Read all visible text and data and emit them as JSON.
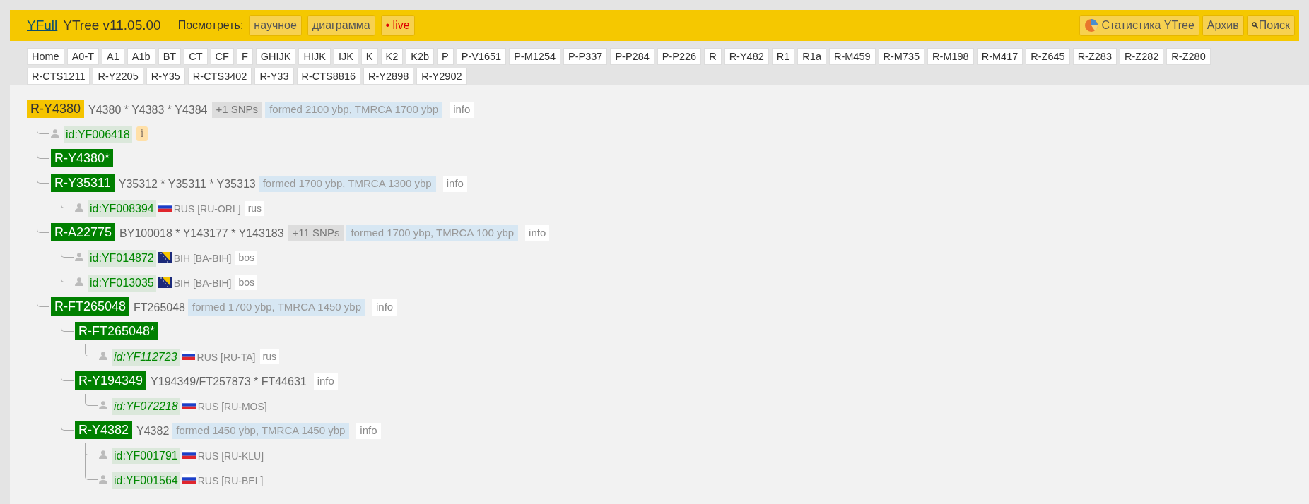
{
  "header": {
    "logo_link": "YFull",
    "title": "YTree v11.05.00",
    "view_label": "Посмотреть:",
    "view_buttons": [
      {
        "label": "научное",
        "kind": "plain"
      },
      {
        "label": "диаграмма",
        "kind": "plain"
      },
      {
        "label": "• live",
        "kind": "live"
      }
    ],
    "right_buttons": [
      {
        "label": "Статистика YTree",
        "kind": "stats"
      },
      {
        "label": "Архив",
        "kind": "plain"
      },
      {
        "label": "Поиск",
        "kind": "search"
      }
    ]
  },
  "tabs": [
    "Home",
    "A0-T",
    "A1",
    "A1b",
    "BT",
    "CT",
    "CF",
    "F",
    "GHIJK",
    "HIJK",
    "IJK",
    "K",
    "K2",
    "K2b",
    "P",
    "P-V1651",
    "P-M1254",
    "P-P337",
    "P-P284",
    "P-P226",
    "R",
    "R-Y482",
    "R1",
    "R1a",
    "R-M459",
    "R-M735",
    "R-M198",
    "R-M417",
    "R-Z645",
    "R-Z283",
    "R-Z282",
    "R-Z280",
    "R-CTS1211",
    "R-Y2205",
    "R-Y35",
    "R-CTS3402",
    "R-Y33",
    "R-CTS8816",
    "R-Y2898",
    "R-Y2902"
  ],
  "tree": {
    "kind": "clade",
    "name": "R-Y4380",
    "selected": true,
    "snps": "Y4380 * Y4383 * Y4384",
    "more_snps": "+1 SNPs",
    "age": "formed 2100 ybp, TMRCA 1700 ybp",
    "info": "info",
    "children": [
      {
        "kind": "sample",
        "id": "id:YF006418",
        "italic": false,
        "note": "i"
      },
      {
        "kind": "clade",
        "name": "R-Y4380*",
        "selected": false
      },
      {
        "kind": "clade",
        "name": "R-Y35311",
        "selected": false,
        "snps": "Y35312 * Y35311 * Y35313",
        "age": "formed 1700 ybp, TMRCA 1300 ybp",
        "info": "info",
        "children": [
          {
            "kind": "sample",
            "id": "id:YF008394",
            "italic": false,
            "flag": {
              "kind": "ru"
            },
            "country": "RUS [RU-ORL]",
            "lang": "rus"
          }
        ]
      },
      {
        "kind": "clade",
        "name": "R-A22775",
        "selected": false,
        "snps": "BY100018 * Y143177 * Y143183",
        "more_snps": "+11 SNPs",
        "age": "formed 1700 ybp, TMRCA 100 ybp",
        "info": "info",
        "children": [
          {
            "kind": "sample",
            "id": "id:YF014872",
            "italic": false,
            "flag": {
              "kind": "ba"
            },
            "country": "BIH [BA-BIH]",
            "lang": "bos"
          },
          {
            "kind": "sample",
            "id": "id:YF013035",
            "italic": false,
            "flag": {
              "kind": "ba"
            },
            "country": "BIH [BA-BIH]",
            "lang": "bos"
          }
        ]
      },
      {
        "kind": "clade",
        "name": "R-FT265048",
        "selected": false,
        "snps": "FT265048",
        "age": "formed 1700 ybp, TMRCA 1450 ybp",
        "info": "info",
        "children": [
          {
            "kind": "clade",
            "name": "R-FT265048*",
            "selected": false,
            "children": [
              {
                "kind": "sample",
                "id": "id:YF112723",
                "italic": true,
                "flag": {
                  "kind": "ru"
                },
                "country": "RUS [RU-TA]",
                "lang": "rus"
              }
            ]
          },
          {
            "kind": "clade",
            "name": "R-Y194349",
            "selected": false,
            "snps": "Y194349/FT257873 * FT44631",
            "info": "info",
            "children": [
              {
                "kind": "sample",
                "id": "id:YF072218",
                "italic": true,
                "flag": {
                  "kind": "ru"
                },
                "country": "RUS [RU-MOS]"
              }
            ]
          },
          {
            "kind": "clade",
            "name": "R-Y4382",
            "selected": false,
            "snps": "Y4382",
            "age": "formed 1450 ybp, TMRCA 1450 ybp",
            "info": "info",
            "children": [
              {
                "kind": "sample",
                "id": "id:YF001791",
                "italic": false,
                "flag": {
                  "kind": "ru"
                },
                "country": "RUS [RU-KLU]"
              },
              {
                "kind": "sample",
                "id": "id:YF001564",
                "italic": false,
                "flag": {
                  "kind": "ru"
                },
                "country": "RUS [RU-BEL]"
              }
            ]
          }
        ]
      }
    ]
  }
}
